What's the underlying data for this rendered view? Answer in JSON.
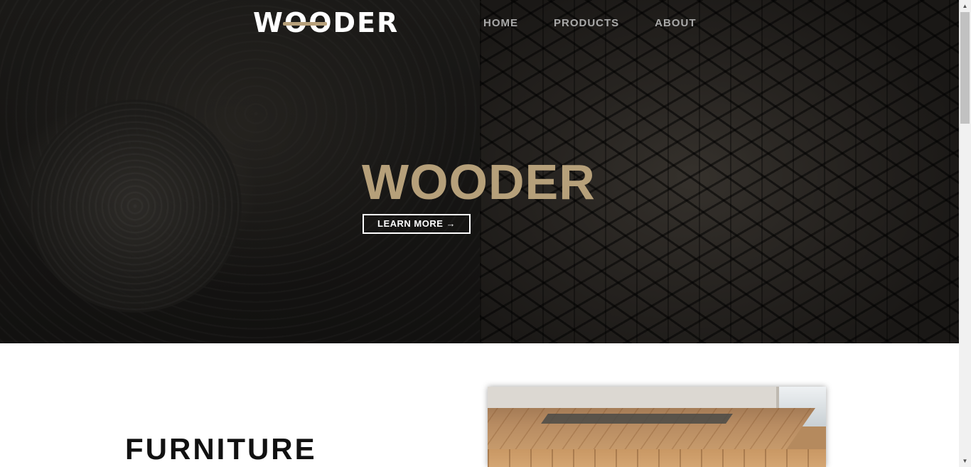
{
  "header": {
    "logo_text": "WOODER",
    "nav": [
      {
        "label": "HOME"
      },
      {
        "label": "PRODUCTS"
      },
      {
        "label": "ABOUT"
      }
    ]
  },
  "hero": {
    "title": "WOODER",
    "cta_label": "LEARN MORE →"
  },
  "section": {
    "title": "FURNITURE"
  },
  "colors": {
    "accent": "#b6a07a",
    "hero_background": "#141312",
    "page_background": "#ffffff",
    "nav_text": "#a9a9a9"
  },
  "scrollbar": {
    "up_icon": "triangle-up-icon",
    "down_icon": "triangle-down-icon"
  }
}
